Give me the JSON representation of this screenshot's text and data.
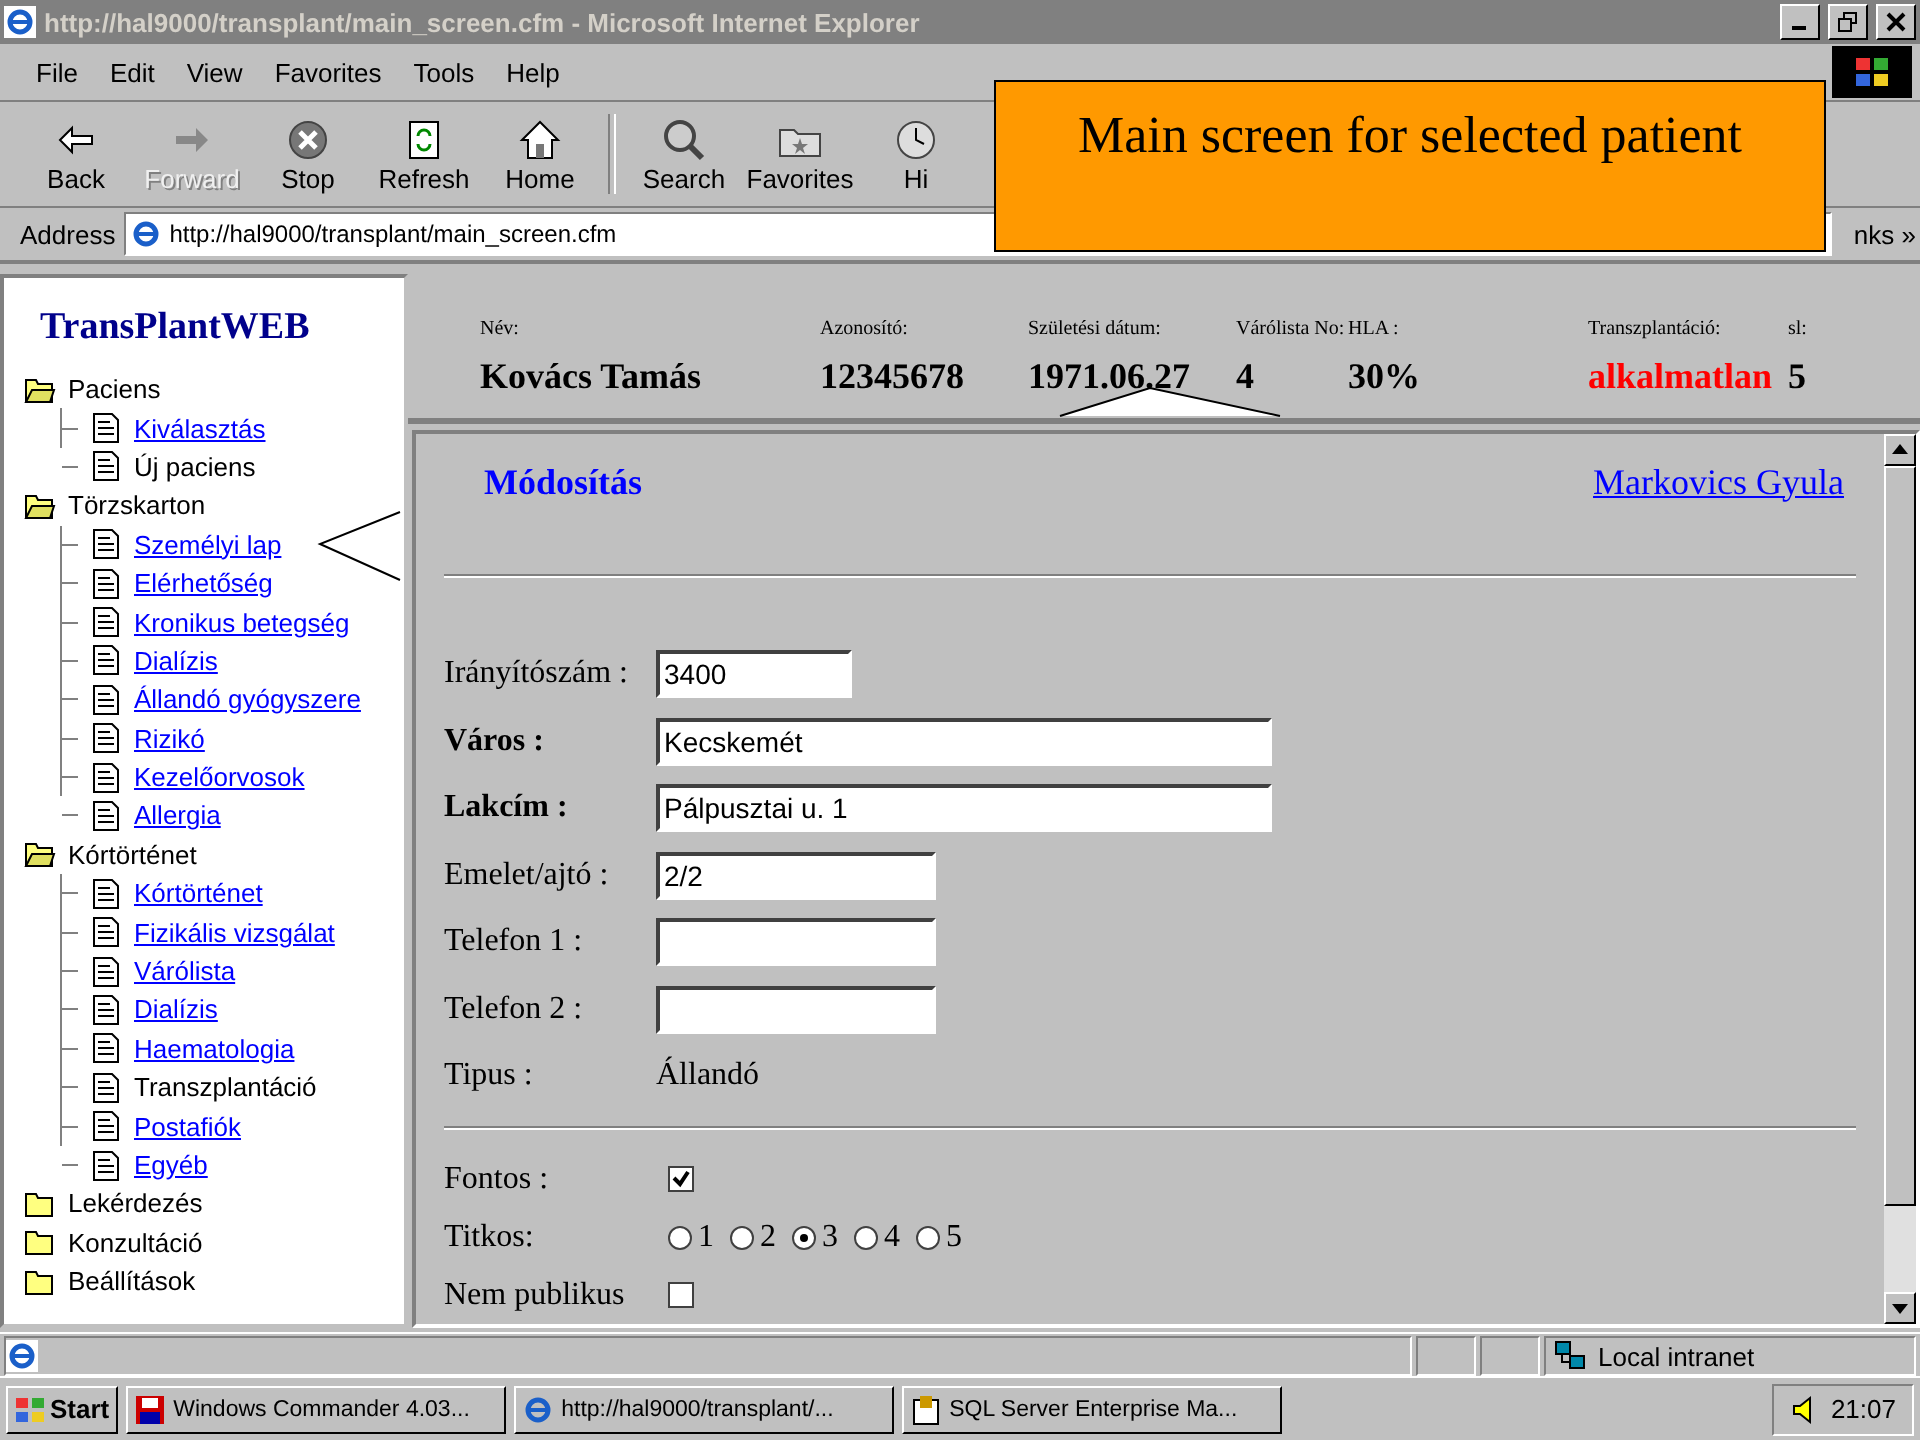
{
  "window": {
    "title": "http://hal9000/transplant/main_screen.cfm - Microsoft Internet Explorer"
  },
  "menu": [
    "File",
    "Edit",
    "View",
    "Favorites",
    "Tools",
    "Help"
  ],
  "toolbar": [
    {
      "kind": "back",
      "label": "Back",
      "disabled": false
    },
    {
      "kind": "forward",
      "label": "Forward",
      "disabled": true
    },
    {
      "kind": "stop",
      "label": "Stop",
      "disabled": false
    },
    {
      "kind": "refresh",
      "label": "Refresh",
      "disabled": false
    },
    {
      "kind": "home",
      "label": "Home",
      "disabled": false
    },
    {
      "kind": "search",
      "label": "Search",
      "disabled": false
    },
    {
      "kind": "favorites",
      "label": "Favorites",
      "disabled": false
    },
    {
      "kind": "history",
      "label": "Hi",
      "disabled": false
    }
  ],
  "address": {
    "label": "Address",
    "value": "http://hal9000/transplant/main_screen.cfm",
    "links": "nks",
    "links_more": "»"
  },
  "callout": {
    "text": "Main screen for selected patient"
  },
  "sidebar": {
    "logo": "TransPlantWEB",
    "tree": [
      {
        "label": "Paciens",
        "expanded": true,
        "children": [
          {
            "label": "Kiválasztás",
            "link": true
          },
          {
            "label": "Új paciens",
            "link": false
          }
        ]
      },
      {
        "label": "Törzskarton",
        "expanded": true,
        "children": [
          {
            "label": "Személyi lap",
            "link": true
          },
          {
            "label": "Elérhetőség",
            "link": true
          },
          {
            "label": "Kronikus betegség",
            "link": true
          },
          {
            "label": "Dialízis",
            "link": true
          },
          {
            "label": "Állandó gyógyszere",
            "link": true
          },
          {
            "label": "Rizikó",
            "link": true
          },
          {
            "label": "Kezelőorvosok",
            "link": true
          },
          {
            "label": "Allergia",
            "link": true
          }
        ]
      },
      {
        "label": "Kórtörténet",
        "expanded": true,
        "children": [
          {
            "label": "Kórtörténet",
            "link": true
          },
          {
            "label": "Fizikális vizsgálat",
            "link": true
          },
          {
            "label": "Várólista",
            "link": true
          },
          {
            "label": "Dialízis",
            "link": true
          },
          {
            "label": "Haematologia",
            "link": true
          },
          {
            "label": "Transzplantáció",
            "link": false
          },
          {
            "label": "Postafiók",
            "link": true
          },
          {
            "label": "Egyéb",
            "link": true
          }
        ]
      },
      {
        "label": "Lekérdezés",
        "expanded": false
      },
      {
        "label": "Konzultáció",
        "expanded": false
      },
      {
        "label": "Beállítások",
        "expanded": false
      }
    ]
  },
  "patient": [
    {
      "label": "Név:",
      "value": "Kovács Tamás",
      "alert": false
    },
    {
      "label": "Azonosító:",
      "value": "12345678",
      "alert": false
    },
    {
      "label": "Születési dátum:",
      "value": "1971.06.27",
      "alert": false
    },
    {
      "label": "Várólista No:",
      "value": "4",
      "alert": false
    },
    {
      "label": "HLA :",
      "value": "30%",
      "alert": false
    },
    {
      "label": "Transzplantáció:",
      "value": "alkalmatlan",
      "alert": true
    },
    {
      "label": "sl:",
      "value": "5",
      "alert": false
    }
  ],
  "form": {
    "title": "Módosítás",
    "user": "Markovics Gyula",
    "fields": [
      {
        "label": "Irányítószám :",
        "value": "3400",
        "bold": false,
        "kind": "short"
      },
      {
        "label": "Város :",
        "value": "Kecskemét",
        "bold": true,
        "kind": "long"
      },
      {
        "label": "Lakcím :",
        "value": "Pálpusztai u. 1",
        "bold": true,
        "kind": "long"
      },
      {
        "label": "Emelet/ajtó :",
        "value": "2/2",
        "bold": false,
        "kind": "medium"
      },
      {
        "label": "Telefon 1 :",
        "bold": false,
        "kind": "medium"
      },
      {
        "label": "Telefon 2 :",
        "bold": false,
        "kind": "medium"
      },
      {
        "label": "Tipus :",
        "value": "Állandó",
        "bold": false,
        "kind": "text"
      }
    ],
    "fontos": {
      "label": "Fontos :",
      "checked": true
    },
    "titkos": {
      "label": "Titkos:",
      "options": [
        {
          "label": "1",
          "selected": false
        },
        {
          "label": "2",
          "selected": false
        },
        {
          "label": "3",
          "selected": true
        },
        {
          "label": "4",
          "selected": false
        },
        {
          "label": "5",
          "selected": false
        }
      ]
    },
    "nem_publikus": {
      "label": "Nem publikus",
      "checked": false
    }
  },
  "status": {
    "zone": "Local intranet"
  },
  "taskbar": {
    "start": "Start",
    "tasks": [
      {
        "kind": "commander",
        "label": "Windows Commander 4.03..."
      },
      {
        "kind": "ie",
        "label": "http://hal9000/transplant/..."
      },
      {
        "kind": "sql",
        "label": "SQL Server Enterprise Ma..."
      }
    ],
    "clock": "21:07"
  }
}
